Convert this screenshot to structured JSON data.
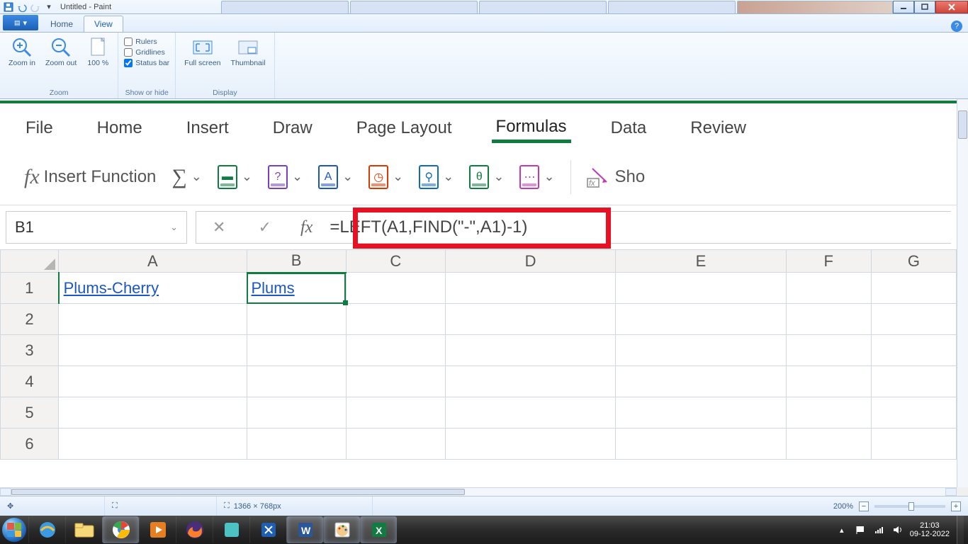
{
  "paint": {
    "title": "Untitled - Paint",
    "tabs": {
      "home": "Home",
      "view": "View"
    },
    "zoom": {
      "in": "Zoom in",
      "out": "Zoom out",
      "pct": "100 %",
      "group": "Zoom"
    },
    "showhide": {
      "rulers": "Rulers",
      "gridlines": "Gridlines",
      "statusbar": "Status bar",
      "group": "Show or hide"
    },
    "display": {
      "full": "Full screen",
      "thumb": "Thumbnail",
      "group": "Display"
    }
  },
  "excel": {
    "tabs": {
      "file": "File",
      "home": "Home",
      "insert": "Insert",
      "draw": "Draw",
      "pagelayout": "Page Layout",
      "formulas": "Formulas",
      "data": "Data",
      "review": "Review"
    },
    "ribbon": {
      "insertfn": "Insert Function",
      "show": "Sho"
    },
    "namebox": "B1",
    "formula": "=LEFT(A1,FIND(\"-\",A1)-1)",
    "cols": [
      "A",
      "B",
      "C",
      "D",
      "E",
      "F",
      "G"
    ],
    "rows": [
      "1",
      "2",
      "3",
      "4",
      "5",
      "6"
    ],
    "cells": {
      "A1": "Plums-Cherry",
      "B1": "Plums"
    },
    "selected": "B1"
  },
  "status": {
    "canvas_size": "1366 × 768px",
    "zoom_pct": "200%"
  },
  "system": {
    "time": "21:03",
    "date": "09-12-2022"
  }
}
